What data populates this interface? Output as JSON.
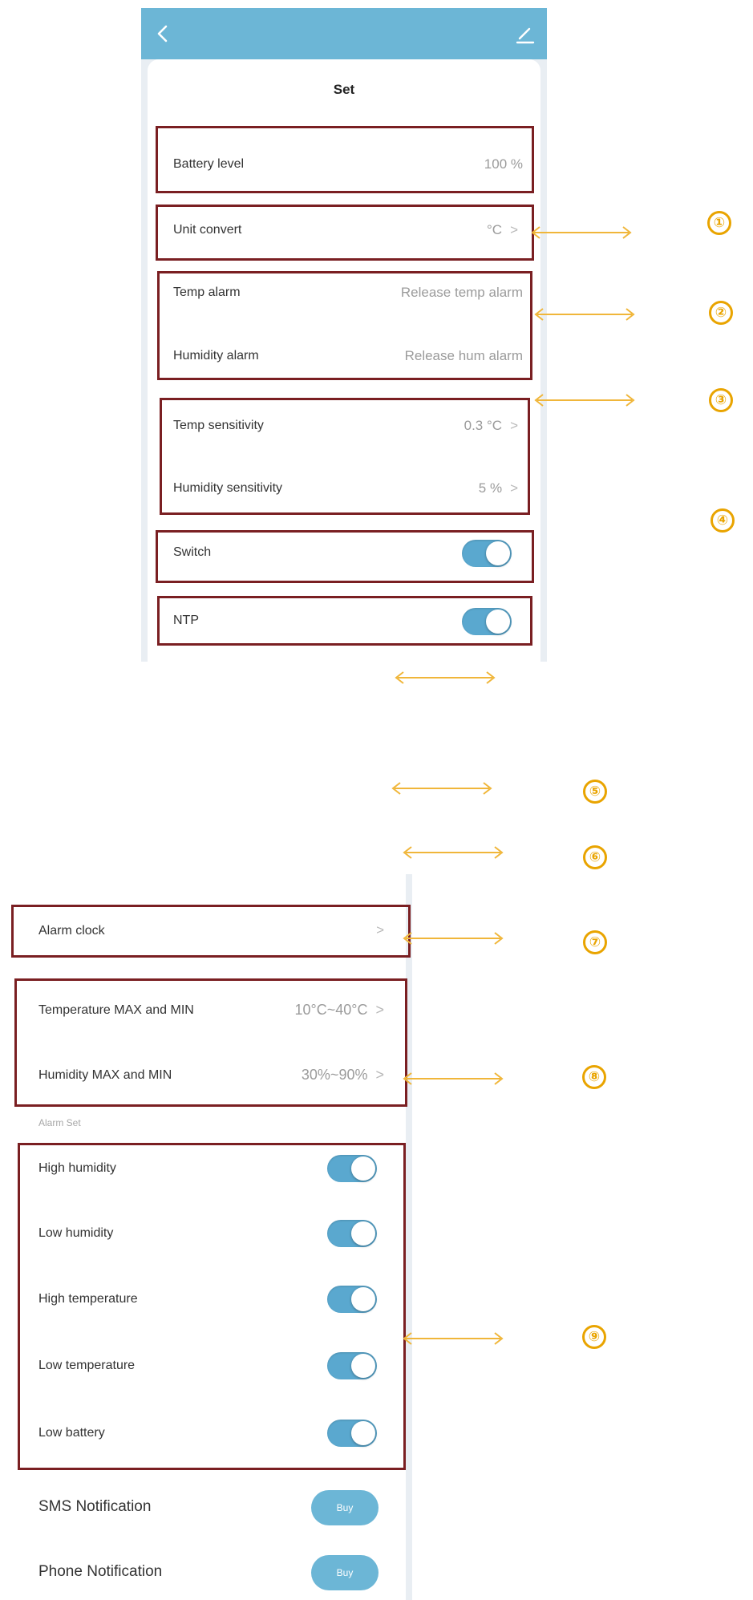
{
  "screen1": {
    "title": "Set",
    "battery": {
      "label": "Battery level",
      "value": "100 %"
    },
    "unit": {
      "label": "Unit convert",
      "value": "°C"
    },
    "temp_alarm": {
      "label": "Temp alarm",
      "value": "Release temp alarm"
    },
    "hum_alarm": {
      "label": "Humidity alarm",
      "value": "Release hum alarm"
    },
    "temp_sens": {
      "label": "Temp sensitivity",
      "value": "0.3 °C"
    },
    "hum_sens": {
      "label": "Humidity sensitivity",
      "value": "5 %"
    },
    "switch": {
      "label": "Switch",
      "on": true
    },
    "ntp": {
      "label": "NTP",
      "on": true
    }
  },
  "screen2": {
    "alarm_clock": {
      "label": "Alarm clock"
    },
    "temp_range": {
      "label": "Temperature MAX and MIN",
      "value": "10°C~40°C"
    },
    "hum_range": {
      "label": "Humidity MAX and MIN",
      "value": "30%~90%"
    },
    "alarm_set_caption": "Alarm Set",
    "alarms": [
      {
        "label": "High humidity",
        "on": true
      },
      {
        "label": "Low humidity",
        "on": true
      },
      {
        "label": "High temperature",
        "on": true
      },
      {
        "label": "Low temperature",
        "on": true
      },
      {
        "label": "Low battery",
        "on": true
      }
    ],
    "sms": {
      "label": "SMS Notification",
      "button": "Buy"
    },
    "phone": {
      "label": "Phone Notification",
      "button": "Buy"
    }
  },
  "annotations": [
    "①",
    "②",
    "③",
    "④",
    "⑤",
    "⑥",
    "⑦",
    "⑧",
    "⑨"
  ],
  "colors": {
    "accent": "#6cb6d6",
    "toggle_on": "#5aa8cf",
    "annotation_box": "#7a1f22",
    "arrow": "#f0b63a"
  },
  "icons": {
    "back": "chevron-left-icon",
    "edit": "pencil-icon",
    "row_arrow": "chevron-right-icon"
  }
}
